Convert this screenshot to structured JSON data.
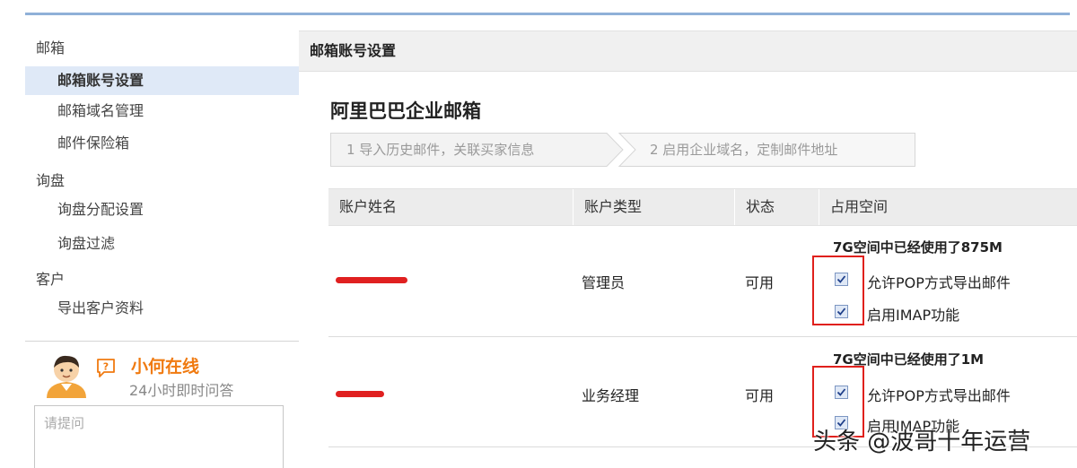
{
  "sidebar": {
    "sections": [
      {
        "title": "邮箱",
        "items": [
          {
            "label": "邮箱账号设置",
            "active": true
          },
          {
            "label": "邮箱域名管理",
            "active": false
          },
          {
            "label": "邮件保险箱",
            "active": false
          }
        ]
      },
      {
        "title": "询盘",
        "items": [
          {
            "label": "询盘分配设置",
            "active": false
          },
          {
            "label": "询盘过滤",
            "active": false
          }
        ]
      },
      {
        "title": "客户",
        "items": [
          {
            "label": "导出客户资料",
            "active": false
          }
        ]
      }
    ],
    "assistant": {
      "name": "小何在线",
      "subtitle": "24小时即时问答",
      "input_placeholder": "请提问"
    }
  },
  "main": {
    "header_title": "邮箱账号设置",
    "page_title": "阿里巴巴企业邮箱",
    "steps": [
      {
        "label": "1 导入历史邮件，关联买家信息"
      },
      {
        "label": "2 启用企业域名，定制邮件地址"
      }
    ],
    "table": {
      "columns": [
        "账户姓名",
        "账户类型",
        "状态",
        "占用空间"
      ],
      "rows": [
        {
          "type": "管理员",
          "status": "可用",
          "usage": "7G空间中已经使用了875M",
          "options": [
            {
              "label": "允许POP方式导出邮件",
              "checked": true
            },
            {
              "label": "启用IMAP功能",
              "checked": true
            }
          ]
        },
        {
          "type": "业务经理",
          "status": "可用",
          "usage": "7G空间中已经使用了1M",
          "options": [
            {
              "label": "允许POP方式导出邮件",
              "checked": true
            },
            {
              "label": "启用IMAP功能",
              "checked": true
            }
          ]
        }
      ]
    }
  },
  "watermark": "头条 @波哥十年运营",
  "colors": {
    "accent_line": "#8fb0d8",
    "active_item_bg": "#dfe9f7",
    "assistant_name": "#f07a10",
    "highlight_red": "#e0201c"
  }
}
